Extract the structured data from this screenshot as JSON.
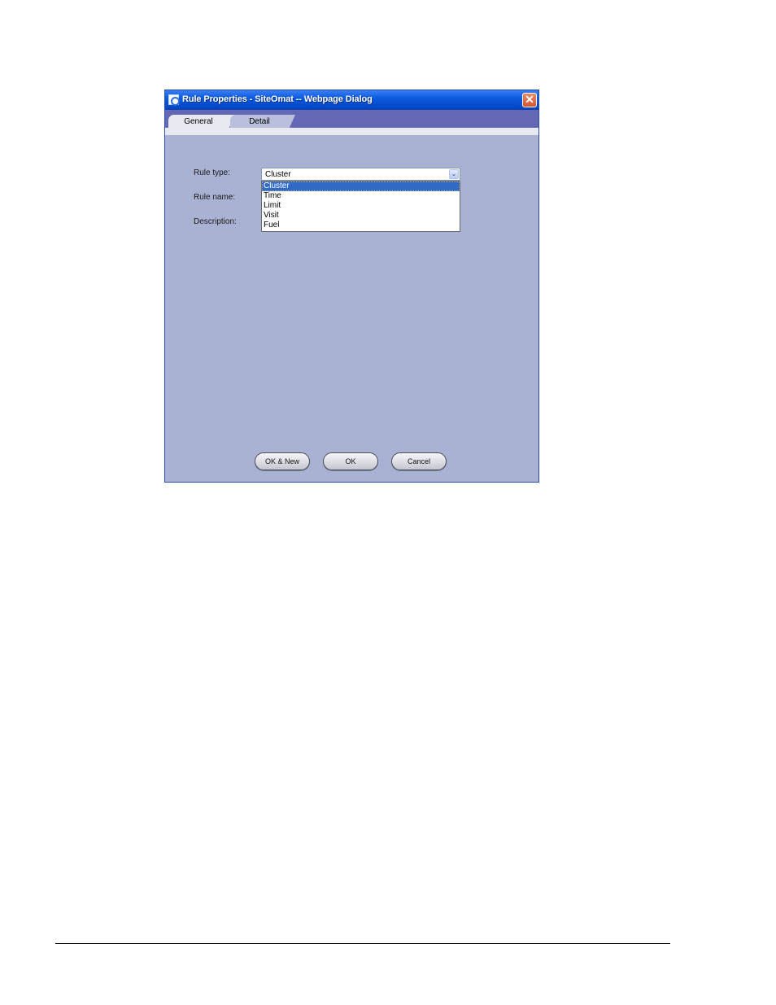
{
  "window": {
    "title": "Rule Properties - SiteOmat -- Webpage Dialog",
    "close_glyph": "✕"
  },
  "tabs": [
    {
      "label": "General",
      "active": true
    },
    {
      "label": "Detail",
      "active": false
    }
  ],
  "form": {
    "rule_type_label": "Rule type:",
    "rule_name_label": "Rule name:",
    "description_label": "Description:",
    "rule_type_value": "Cluster",
    "dropdown_arrow": "⌄",
    "options": [
      {
        "label": "Cluster",
        "selected": true
      },
      {
        "label": "Time",
        "selected": false
      },
      {
        "label": "Limit",
        "selected": false
      },
      {
        "label": "Visit",
        "selected": false
      },
      {
        "label": "Fuel",
        "selected": false
      }
    ]
  },
  "buttons": {
    "ok_new": "OK & New",
    "ok": "OK",
    "cancel": "Cancel"
  },
  "colors": {
    "titlebar": "#0a5ae0",
    "tabstrip": "#6467b4",
    "body": "#aab2d3",
    "selection": "#316ac5"
  }
}
